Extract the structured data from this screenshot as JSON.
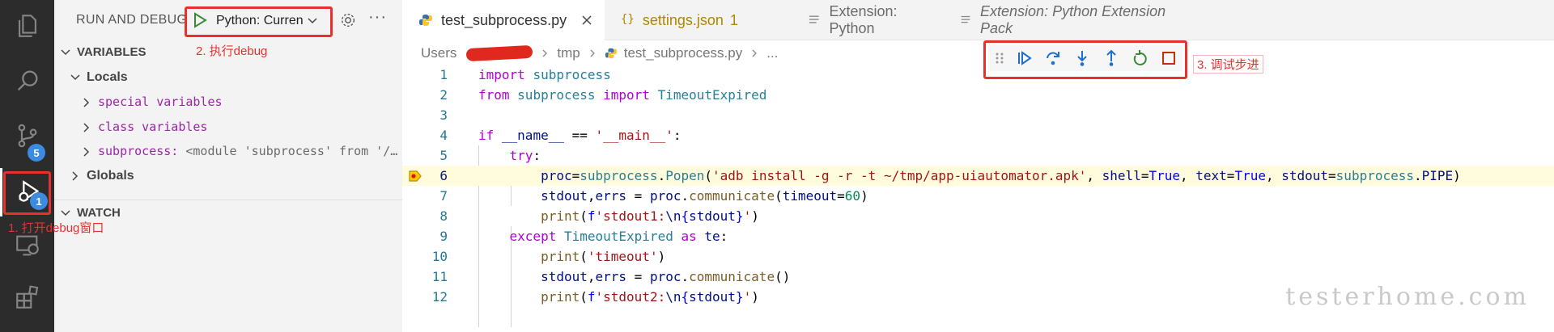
{
  "activity_bar": {
    "items": [
      {
        "name": "explorer-icon"
      },
      {
        "name": "search-icon"
      },
      {
        "name": "source-control-icon",
        "badge": "5"
      },
      {
        "name": "run-debug-icon",
        "badge": "1"
      },
      {
        "name": "remote-explorer-icon"
      },
      {
        "name": "extensions-icon"
      }
    ]
  },
  "sidebar": {
    "title": "RUN AND DEBUG",
    "config_label": "Python: Curren",
    "variables_label": "VARIABLES",
    "locals_label": "Locals",
    "special_variables": "special variables",
    "class_variables": "class variables",
    "subprocess_name": "subprocess:",
    "subprocess_value": "<module 'subprocess' from '/…",
    "globals_label": "Globals",
    "watch_label": "WATCH"
  },
  "annotations": {
    "open_debug": "1. 打开debug窗口",
    "run_debug": "2. 执行debug",
    "step_debug": "3. 调试步进",
    "color": "#e5322f"
  },
  "tabs": [
    {
      "label": "test_subprocess.py",
      "icon": "python-icon"
    },
    {
      "label": "settings.json",
      "count": "1",
      "icon": "json-icon"
    },
    {
      "label": "Extension: Python",
      "icon": "extension-icon"
    },
    {
      "label": "Extension: Python Extension Pack",
      "icon": "extension-icon"
    }
  ],
  "breadcrumb": {
    "root": "Users",
    "folder": "tmp",
    "file": "test_subprocess.py",
    "tail": "..."
  },
  "debug_toolbar": {
    "buttons": [
      "continue-icon",
      "step-over-icon",
      "step-into-icon",
      "step-out-icon",
      "restart-icon",
      "stop-icon"
    ]
  },
  "editor": {
    "current_line": 6,
    "line_numbers": [
      "1",
      "2",
      "3",
      "4",
      "5",
      "6",
      "7",
      "8",
      "9",
      "10",
      "11",
      "12"
    ],
    "lines": [
      [
        {
          "t": "import",
          "c": "kw"
        },
        {
          "t": " ",
          "c": "plain"
        },
        {
          "t": "subprocess",
          "c": "mod"
        }
      ],
      [
        {
          "t": "from",
          "c": "kw"
        },
        {
          "t": " ",
          "c": "plain"
        },
        {
          "t": "subprocess",
          "c": "mod"
        },
        {
          "t": " ",
          "c": "plain"
        },
        {
          "t": "import",
          "c": "kw"
        },
        {
          "t": " ",
          "c": "plain"
        },
        {
          "t": "TimeoutExpired",
          "c": "mod"
        }
      ],
      [],
      [
        {
          "t": "if",
          "c": "kw"
        },
        {
          "t": " ",
          "c": "plain"
        },
        {
          "t": "__name__",
          "c": "var"
        },
        {
          "t": " == ",
          "c": "plain"
        },
        {
          "t": "'__main__'",
          "c": "str"
        },
        {
          "t": ":",
          "c": "plain"
        }
      ],
      [
        {
          "t": "    ",
          "c": "plain"
        },
        {
          "t": "try",
          "c": "kw"
        },
        {
          "t": ":",
          "c": "plain"
        }
      ],
      [
        {
          "t": "        ",
          "c": "plain"
        },
        {
          "t": "proc",
          "c": "var"
        },
        {
          "t": "=",
          "c": "plain"
        },
        {
          "t": "subprocess",
          "c": "mod"
        },
        {
          "t": ".",
          "c": "plain"
        },
        {
          "t": "Popen",
          "c": "mod"
        },
        {
          "t": "(",
          "c": "plain"
        },
        {
          "t": "'adb install -g -r -t ~/tmp/app-uiautomator.apk'",
          "c": "str"
        },
        {
          "t": ", ",
          "c": "plain"
        },
        {
          "t": "shell",
          "c": "var"
        },
        {
          "t": "=",
          "c": "plain"
        },
        {
          "t": "True",
          "c": "kw2"
        },
        {
          "t": ", ",
          "c": "plain"
        },
        {
          "t": "text",
          "c": "var"
        },
        {
          "t": "=",
          "c": "plain"
        },
        {
          "t": "True",
          "c": "kw2"
        },
        {
          "t": ", ",
          "c": "plain"
        },
        {
          "t": "stdout",
          "c": "var"
        },
        {
          "t": "=",
          "c": "plain"
        },
        {
          "t": "subprocess",
          "c": "mod"
        },
        {
          "t": ".",
          "c": "plain"
        },
        {
          "t": "PIPE",
          "c": "var"
        },
        {
          "t": ")",
          "c": "plain"
        }
      ],
      [
        {
          "t": "        ",
          "c": "plain"
        },
        {
          "t": "stdout",
          "c": "var"
        },
        {
          "t": ",",
          "c": "plain"
        },
        {
          "t": "errs",
          "c": "var"
        },
        {
          "t": " = ",
          "c": "plain"
        },
        {
          "t": "proc",
          "c": "var"
        },
        {
          "t": ".",
          "c": "plain"
        },
        {
          "t": "communicate",
          "c": "fn"
        },
        {
          "t": "(",
          "c": "plain"
        },
        {
          "t": "timeout",
          "c": "var"
        },
        {
          "t": "=",
          "c": "plain"
        },
        {
          "t": "60",
          "c": "num"
        },
        {
          "t": ")",
          "c": "plain"
        }
      ],
      [
        {
          "t": "        ",
          "c": "plain"
        },
        {
          "t": "print",
          "c": "fn"
        },
        {
          "t": "(",
          "c": "plain"
        },
        {
          "t": "f",
          "c": "kw2"
        },
        {
          "t": "'stdout1:",
          "c": "str"
        },
        {
          "t": "\\n",
          "c": "var"
        },
        {
          "t": "{",
          "c": "kw2"
        },
        {
          "t": "stdout",
          "c": "var"
        },
        {
          "t": "}",
          "c": "kw2"
        },
        {
          "t": "'",
          "c": "str"
        },
        {
          "t": ")",
          "c": "plain"
        }
      ],
      [
        {
          "t": "    ",
          "c": "plain"
        },
        {
          "t": "except",
          "c": "kw"
        },
        {
          "t": " ",
          "c": "plain"
        },
        {
          "t": "TimeoutExpired",
          "c": "mod"
        },
        {
          "t": " ",
          "c": "plain"
        },
        {
          "t": "as",
          "c": "kw"
        },
        {
          "t": " ",
          "c": "plain"
        },
        {
          "t": "te",
          "c": "var"
        },
        {
          "t": ":",
          "c": "plain"
        }
      ],
      [
        {
          "t": "        ",
          "c": "plain"
        },
        {
          "t": "print",
          "c": "fn"
        },
        {
          "t": "(",
          "c": "plain"
        },
        {
          "t": "'timeout'",
          "c": "str"
        },
        {
          "t": ")",
          "c": "plain"
        }
      ],
      [
        {
          "t": "        ",
          "c": "plain"
        },
        {
          "t": "stdout",
          "c": "var"
        },
        {
          "t": ",",
          "c": "plain"
        },
        {
          "t": "errs",
          "c": "var"
        },
        {
          "t": " = ",
          "c": "plain"
        },
        {
          "t": "proc",
          "c": "var"
        },
        {
          "t": ".",
          "c": "plain"
        },
        {
          "t": "communicate",
          "c": "fn"
        },
        {
          "t": "()",
          "c": "plain"
        }
      ],
      [
        {
          "t": "        ",
          "c": "plain"
        },
        {
          "t": "print",
          "c": "fn"
        },
        {
          "t": "(",
          "c": "plain"
        },
        {
          "t": "f",
          "c": "kw2"
        },
        {
          "t": "'stdout2:",
          "c": "str"
        },
        {
          "t": "\\n",
          "c": "var"
        },
        {
          "t": "{",
          "c": "kw2"
        },
        {
          "t": "stdout",
          "c": "var"
        },
        {
          "t": "}",
          "c": "kw2"
        },
        {
          "t": "'",
          "c": "str"
        },
        {
          "t": ")",
          "c": "plain"
        }
      ]
    ]
  },
  "watermark": "testerhome.com"
}
